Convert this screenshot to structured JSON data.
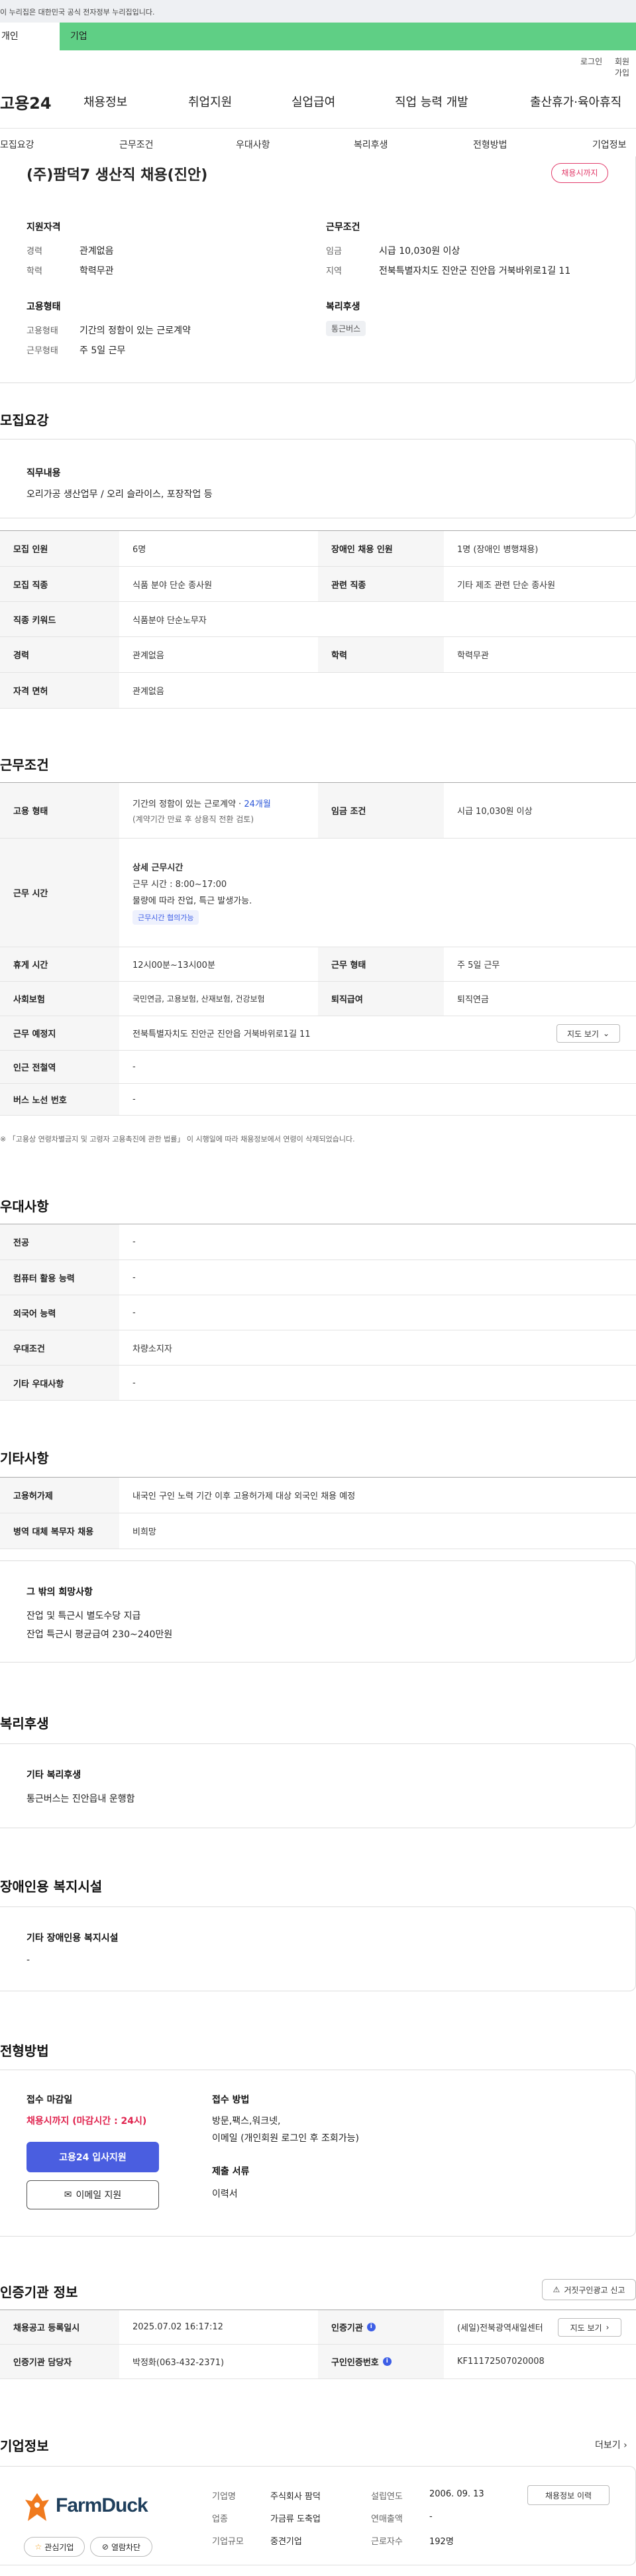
{
  "gov_banner": "이 누리집은 대한민국 공식 전자정부 누리집입니다.",
  "user_tabs": [
    "개인",
    "기업"
  ],
  "util_links": [
    "로그인",
    "회원가입"
  ],
  "logo": "고용24",
  "menu": [
    "채용정보",
    "취업지원",
    "실업급여",
    "직업 능력 개발",
    "출산휴가·육아휴직"
  ],
  "subnav": [
    "모집요강",
    "근무조건",
    "우대사항",
    "복리후생",
    "전형방법",
    "기업정보"
  ],
  "summary": {
    "title": "(주)팜덕7 생산직 채용(진안)",
    "status": "채용시까지",
    "qual_heading": "지원자격",
    "qual": [
      {
        "label": "경력",
        "value": "관계없음"
      },
      {
        "label": "학력",
        "value": "학력무관"
      }
    ],
    "cond_heading": "근무조건",
    "cond": [
      {
        "label": "임금",
        "value": "시급 10,030원 이상"
      },
      {
        "label": "지역",
        "value": "전북특별자치도 진안군 진안읍 거북바위로1길 11"
      }
    ],
    "emp_heading": "고용형태",
    "emp": [
      {
        "label": "고용형태",
        "value": "기간의 정함이 있는 근로계약"
      },
      {
        "label": "근무형태",
        "value": "주 5일 근무"
      }
    ],
    "welfare_heading": "복리후생",
    "welfare_tag": "통근버스"
  },
  "recruit": {
    "heading": "모집요강",
    "duty_label": "직무내용",
    "duty_text": "오리가공 생산업무 / 오리 슬라이스, 포장작업 등",
    "rows": [
      {
        "h1": "모집 인원",
        "v1": "6명",
        "h2": "장애인 채용 인원",
        "v2": "1명 (장애인 병행채용)"
      },
      {
        "h1": "모집 직종",
        "v1": "식품 분야 단순 종사원",
        "h2": "관련 직종",
        "v2": "기타 제조 관련 단순 종사원"
      },
      {
        "h1": "직종 키워드",
        "v1": "식품분야 단순노무자"
      },
      {
        "h1": "경력",
        "v1": "관계없음",
        "h2": "학력",
        "v2": "학력무관"
      },
      {
        "h1": "자격 면허",
        "v1": "관계없음"
      }
    ]
  },
  "work": {
    "heading": "근무조건",
    "emp_type_label": "고용 형태",
    "emp_type_value": "기간의 정함이 있는 근로계약 · ",
    "emp_type_months": "24개월",
    "emp_type_note": "(계약기간 만료 후 상용직 전환 검토)",
    "wage_label": "임금 조건",
    "wage_value": "시급 10,030원 이상",
    "hours_label": "근무 시간",
    "hours_sub": "상세 근무시간",
    "hours_line1": "근무 시간 : 8:00~17:00",
    "hours_line2": "물량에 따라 잔업, 특근 발생가능.",
    "hours_tag": "근무시간 협의가능",
    "rows": [
      {
        "h1": "휴게 시간",
        "v1": "12시00분~13시00분",
        "h2": "근무 형태",
        "v2": "주 5일 근무"
      },
      {
        "h1": "사회보험",
        "v1": "국민연금, 고용보험, 산재보험, 건강보험",
        "h2": "퇴직급여",
        "v2": "퇴직연금"
      },
      {
        "h1": "근무 예정지",
        "v1": "전북특별자치도 진안군 진안읍 거북바위로1길 11",
        "btn": "지도 보기"
      },
      {
        "h1": "인근 전철역",
        "v1": "-"
      },
      {
        "h1": "버스 노선 번호",
        "v1": "-"
      }
    ],
    "footnote": "※ 「고용상 연령차별금지 및 고령자 고용촉진에 관한 법률」 이 시행일에 따라 채용정보에서 연령이 삭제되었습니다."
  },
  "pref": {
    "heading": "우대사항",
    "rows": [
      {
        "h": "전공",
        "v": "-"
      },
      {
        "h": "컴퓨터 활용 능력",
        "v": "-"
      },
      {
        "h": "외국어 능력",
        "v": "-"
      },
      {
        "h": "우대조건",
        "v": "차량소지자"
      },
      {
        "h": "기타 우대사항",
        "v": "-"
      }
    ]
  },
  "etc": {
    "heading": "기타사항",
    "rows": [
      {
        "h": "고용허가제",
        "v": "내국인 구인 노력 기간 이후 고용허가제 대상 외국인 채용 예정"
      },
      {
        "h": "병역 대체 복무자 채용",
        "v": "비희망"
      }
    ],
    "box_heading": "그 밖의 희망사항",
    "box_lines": [
      "잔업 및 특근시 별도수당 지급",
      "잔업 특근시 평균급여 230~240만원"
    ]
  },
  "welfare": {
    "heading": "복리후생",
    "box_heading": "기타 복리후생",
    "box_text": "통근버스는 진안읍내 운행함"
  },
  "disabled": {
    "heading": "장애인용 복지시설",
    "box_heading": "기타 장애인용 복지시설",
    "box_text": "-"
  },
  "process": {
    "heading": "전형방법",
    "deadline_label": "접수 마감일",
    "deadline_value": "채용시까지 (마감시간 : 24시)",
    "apply_button": "고용24 입사지원",
    "email_button": "이메일 지원",
    "method_label": "접수 방법",
    "method_line1": "방문,팩스,워크넷,",
    "method_line2": "이메일 (개인회원 로그인 후 조회가능)",
    "docs_label": "제출 서류",
    "docs_value": "이력서"
  },
  "cert": {
    "heading": "인증기관 정보",
    "report_button": "거짓구인광고 신고",
    "rows": [
      {
        "h1": "채용공고 등록일시",
        "v1": "2025.07.02 16:17:12",
        "h2": "인증기관",
        "v2": "(세일)전북광역새일센터",
        "btn": "지도 보기"
      },
      {
        "h1": "인증기관 담당자",
        "v1": "박정화(063-432-2371)",
        "h2": "구인인증번호",
        "v2": "KF11172507020008"
      }
    ]
  },
  "company": {
    "heading": "기업정보",
    "more": "더보기",
    "logo_text": "FarmDuck",
    "interest_button": "관심기업",
    "block_button": "열람차단",
    "history_button": "채용정보 이력",
    "info": [
      {
        "label": "기업명",
        "value": "주식회사 팜덕"
      },
      {
        "label": "업종",
        "value": "가금류 도축업"
      },
      {
        "label": "기업규모",
        "value": "중견기업"
      }
    ],
    "info2": [
      {
        "label": "설립연도",
        "value": "2006. 09. 13"
      },
      {
        "label": "연매출액",
        "value": "-"
      },
      {
        "label": "근로자수",
        "value": "192명"
      }
    ]
  },
  "colors": {
    "brand_green": "#5fcf85",
    "accent_blue": "#4a5ee0",
    "alert_red": "#e0234e"
  }
}
